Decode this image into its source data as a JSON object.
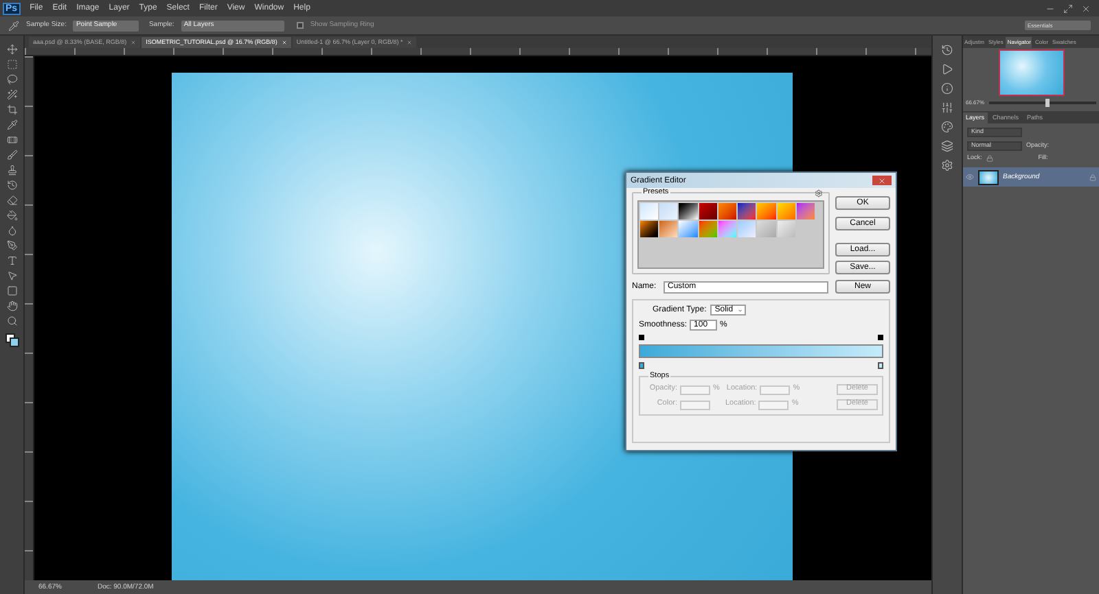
{
  "app": {
    "logo": "Ps",
    "menu": [
      "File",
      "Edit",
      "Image",
      "Layer",
      "Type",
      "Select",
      "Filter",
      "View",
      "Window",
      "Help"
    ]
  },
  "options_bar": {
    "sample_size_label": "Sample Size:",
    "sample_size": "Point Sample",
    "sample_label": "Sample:",
    "sample": "All Layers",
    "show_sampling_ring": {
      "label": "Show Sampling Ring",
      "checked": false
    },
    "workspace": "Essentials"
  },
  "tabs": [
    {
      "label": "aaa.psd @ 8.33% (BASE, RGB/8)",
      "selected": false
    },
    {
      "label": "ISOMETRIC_TUTORIAL.psd @ 16.7% (RGB/8)",
      "selected": true
    },
    {
      "label": "Untitled-1 @ 66.7% (Layer 0, RGB/8) *",
      "selected": false
    }
  ],
  "panels": {
    "top_tabs": [
      {
        "label": "Adjustm",
        "selected": false
      },
      {
        "label": "Styles",
        "selected": false
      },
      {
        "label": "Navigator",
        "selected": true
      },
      {
        "label": "Color",
        "selected": false
      },
      {
        "label": "Swatches",
        "selected": false
      }
    ],
    "navigator": {
      "zoom": "66.67%",
      "level": 0.55
    },
    "layers_tabs": [
      {
        "label": "Layers",
        "selected": true
      },
      {
        "label": "Channels",
        "selected": false
      },
      {
        "label": "Paths",
        "selected": false
      }
    ],
    "kind": "Kind",
    "blend_mode": "Normal",
    "opacity_label": "Opacity:",
    "lock_label": "Lock:",
    "fill_label": "Fill:",
    "layers": [
      {
        "name": "Background",
        "selected": true
      }
    ]
  },
  "status_bar": {
    "zoom": "66.67%",
    "doc": "Doc: 90.0M/72.0M"
  },
  "gradient_editor": {
    "title": "Gradient Editor",
    "presets_label": "Presets",
    "buttons": [
      "OK",
      "Cancel",
      "Load...",
      "Save..."
    ],
    "name_label": "Name:",
    "name": "Custom",
    "new_button": "New",
    "type_label": "Gradient Type:",
    "type": "Solid",
    "smoothness_label": "Smoothness:",
    "smoothness": "100",
    "smoothness_unit": "%",
    "stops_label": "Stops",
    "stop_rows": [
      {
        "label": "Opacity:",
        "unit": "%",
        "location_label": "Location:",
        "location_unit": "%",
        "delete": "Delete"
      },
      {
        "label": "Color:",
        "unit": "",
        "location_label": "Location:",
        "location_unit": "%",
        "delete": "Delete"
      }
    ]
  }
}
